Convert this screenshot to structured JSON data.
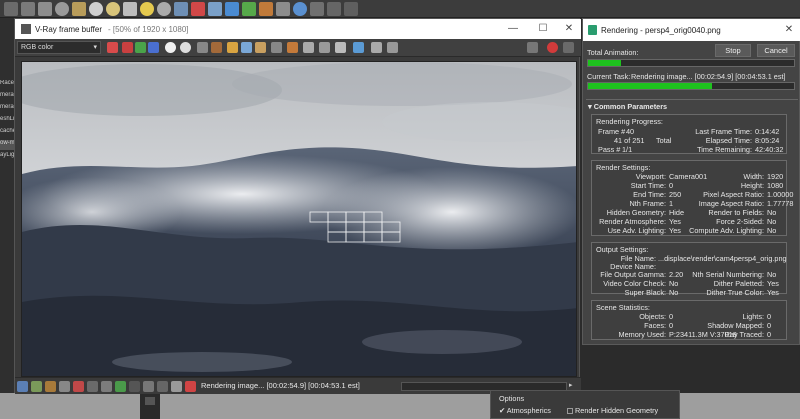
{
  "left_strip": {
    "items": [
      "Racer",
      "mera0",
      "mera0",
      "eshLi",
      "cache",
      "ow-m",
      "ayLigh"
    ]
  },
  "vfb": {
    "title_prefix": "V-Ray frame buffer",
    "title_info": "- [50% of 1920 x 1080]",
    "channel": "RGB color",
    "status_text": "Rendering image... [00:02:54.9] [00:04:53.1 est]"
  },
  "render_dialog": {
    "title": "Rendering - persp4_orig0040.png",
    "stop_label": "Stop",
    "cancel_label": "Cancel",
    "total_animation_label": "Total Animation:",
    "total_animation_progress": 0.16,
    "current_task_label": "Current Task:",
    "current_task_value": "Rendering image... [00:02:54.9] [00:04:53.1 est]",
    "current_task_progress": 0.6,
    "common_params_label": "Common Parameters",
    "rendering_progress_label": "Rendering Progress:",
    "frame_label": "Frame #",
    "frame_value": "40",
    "of_value": "41 of 251",
    "total_label": "Total",
    "pass_label": "Pass #",
    "pass_value": "1/1",
    "last_frame_time_label": "Last Frame Time:",
    "last_frame_time": "0:14:42",
    "elapsed_time_label": "Elapsed Time:",
    "elapsed_time": "8:05:24",
    "time_remaining_label": "Time Remaining:",
    "time_remaining": "42:40:32",
    "render_settings_label": "Render Settings:",
    "render_settings": [
      [
        "Viewport:",
        "Camera001",
        "Width:",
        "1920"
      ],
      [
        "Start Time:",
        "0",
        "Height:",
        "1080"
      ],
      [
        "End Time:",
        "250",
        "Pixel Aspect Ratio:",
        "1.00000"
      ],
      [
        "Nth Frame:",
        "1",
        "Image Aspect Ratio:",
        "1.77778"
      ],
      [
        "Hidden Geometry:",
        "Hide",
        "Render to Fields:",
        "No"
      ],
      [
        "Render Atmosphere:",
        "Yes",
        "Force 2-Sided:",
        "No"
      ],
      [
        "Use Adv. Lighting:",
        "Yes",
        "Compute Adv. Lighting:",
        "No"
      ]
    ],
    "output_settings_label": "Output Settings:",
    "file_name_label": "File Name:",
    "file_name": "...displace\\render\\cam4persp4_orig.png",
    "device_name_label": "Device Name:",
    "output_settings": [
      [
        "File Output Gamma:",
        "2.20",
        "Nth Serial Numbering:",
        "No"
      ],
      [
        "Video Color Check:",
        "No",
        "Dither Paletted:",
        "Yes"
      ],
      [
        "Super Black:",
        "No",
        "Dither True Color:",
        "Yes"
      ]
    ],
    "scene_statistics_label": "Scene Statistics:",
    "scene_statistics": [
      [
        "Objects:",
        "0",
        "Lights:",
        "0"
      ],
      [
        "Faces:",
        "0",
        "Shadow Mapped:",
        "0"
      ],
      [
        "Memory Used:",
        "P:23411.3M V:37018",
        "Ray Traced:",
        "0"
      ]
    ]
  },
  "options_panel": {
    "title": "Options",
    "atmospherics_label": "Atmospherics",
    "atmospherics_checked": true,
    "render_hidden_label": "Render Hidden Geometry"
  }
}
